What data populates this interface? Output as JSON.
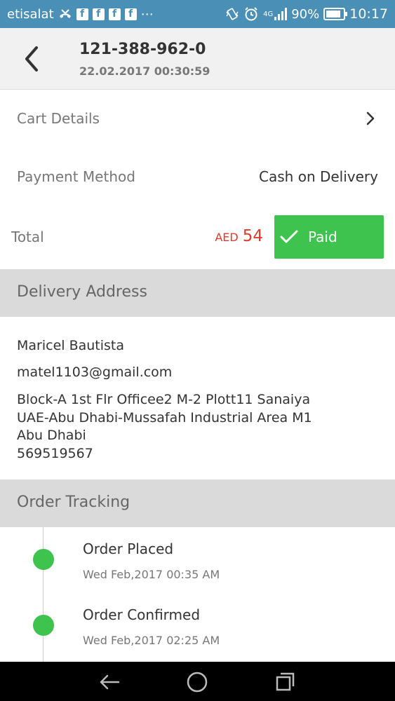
{
  "status_bar": {
    "carrier": "etisalat",
    "notification_icons": [
      "missed-call-icon",
      "facebook-icon",
      "facebook-icon",
      "facebook-icon",
      "facebook-icon",
      "more-icon"
    ],
    "network": "4G",
    "battery": "90%",
    "time": "10:17"
  },
  "header": {
    "order_id": "121-388-962-0",
    "order_datetime": "22.02.2017 00:30:59"
  },
  "cart_details": {
    "label": "Cart Details"
  },
  "payment": {
    "label": "Payment Method",
    "value": "Cash on Delivery"
  },
  "total": {
    "label": "Total",
    "currency": "AED",
    "amount": "54",
    "status_label": "Paid"
  },
  "delivery_address": {
    "section_title": "Delivery Address",
    "name": "Maricel Bautista",
    "email": "matel1103@gmail.com",
    "address_line1": "Block-A 1st Flr Officee2 M-2 Plott11 Sanaiya",
    "address_line2": "UAE-Abu Dhabi-Mussafah Industrial Area M1",
    "city": "Abu Dhabi",
    "phone": "569519567"
  },
  "order_tracking": {
    "section_title": "Order Tracking",
    "steps": [
      {
        "title": "Order Placed",
        "time": "Wed Feb,2017 00:35 AM"
      },
      {
        "title": "Order Confirmed",
        "time": "Wed Feb,2017 02:25 AM"
      }
    ]
  },
  "colors": {
    "status_bar": "#4a8fb5",
    "accent_green": "#3ec34e",
    "price_red": "#e03a2c",
    "section_bg": "#dadada"
  }
}
